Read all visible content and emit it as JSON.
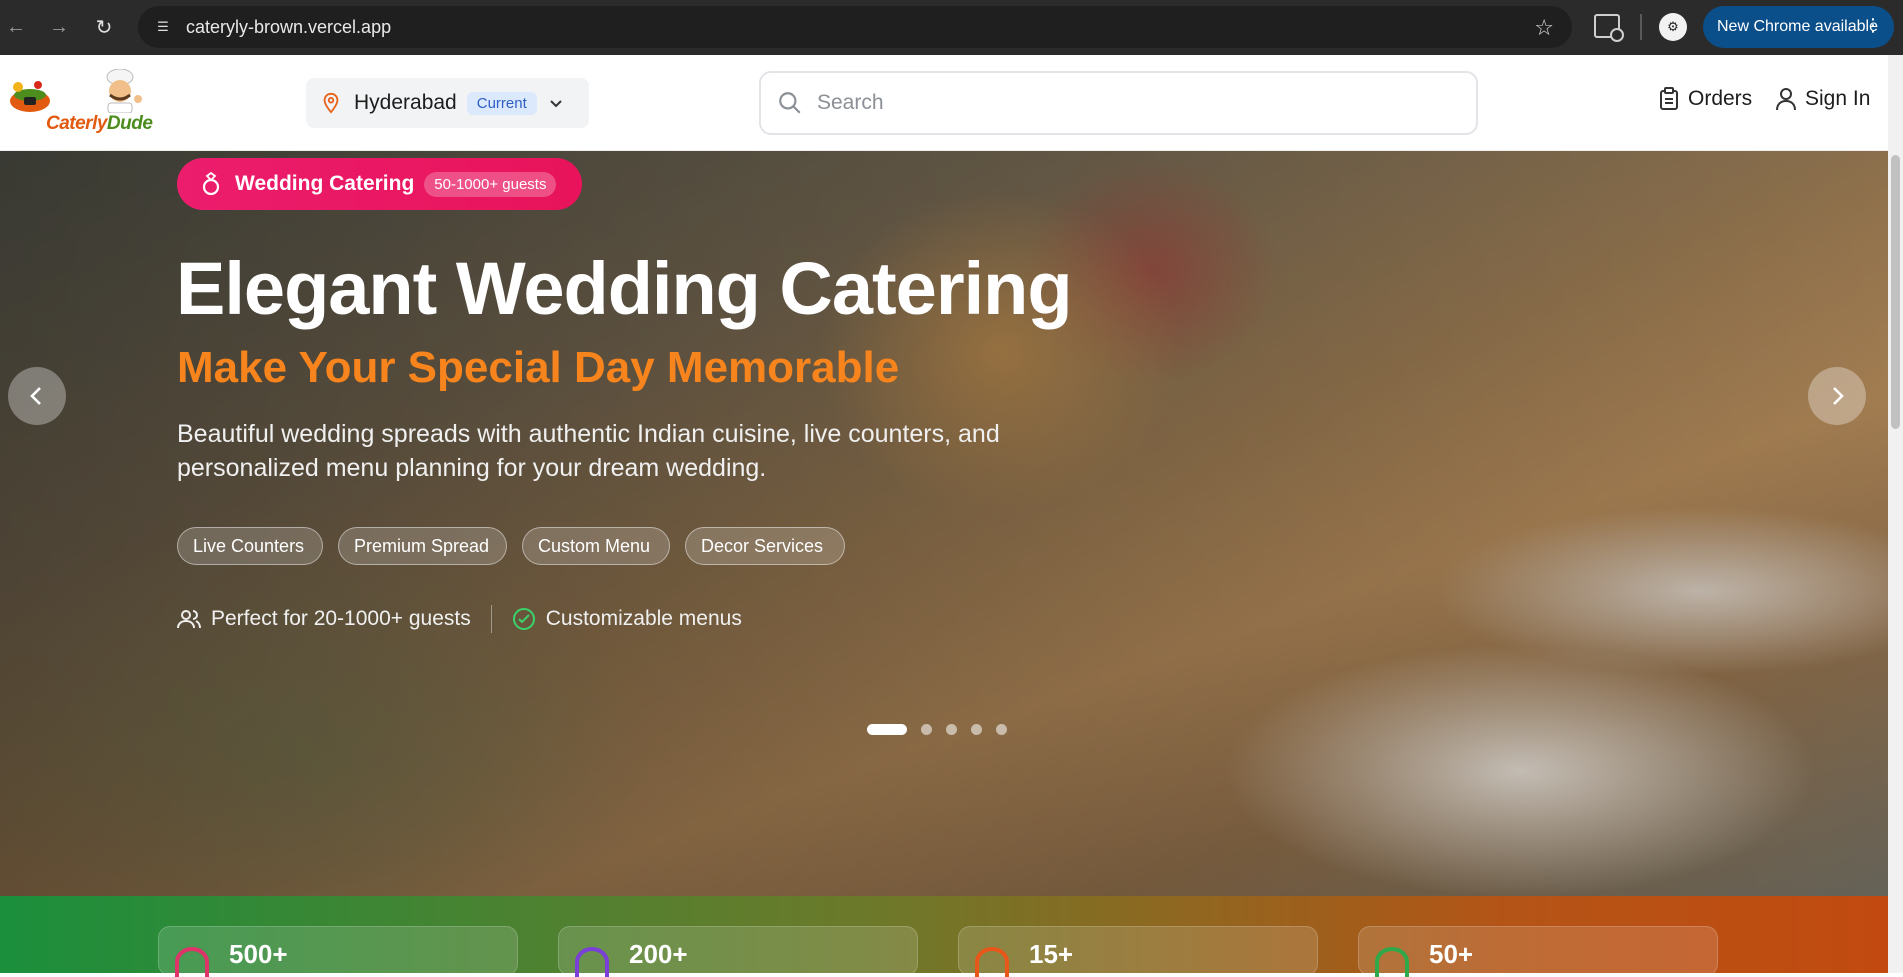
{
  "browser": {
    "url": "cateryly-brown.vercel.app",
    "update_label": "New Chrome available"
  },
  "header": {
    "logo_text_1": "Caterly",
    "logo_text_2": "Dude",
    "location": {
      "city": "Hyderabad",
      "badge": "Current"
    },
    "search_placeholder": "Search",
    "orders_label": "Orders",
    "signin_label": "Sign In"
  },
  "hero": {
    "category_label": "Wedding Catering",
    "category_guests": "50-1000+ guests",
    "title": "Elegant Wedding Catering",
    "subtitle": "Make Your Special Day Memorable",
    "description": "Beautiful wedding spreads with authentic Indian cuisine, live counters, and personalized menu planning for your dream wedding.",
    "chips": [
      "Live Counters",
      "Premium Spread",
      "Custom Menu",
      "Decor Services"
    ],
    "feature_guests": "Perfect for 20-1000+ guests",
    "feature_menus": "Customizable menus",
    "slide_count": 5,
    "active_slide": 1
  },
  "stats": [
    {
      "value": "500+",
      "icon": "heart-icon",
      "color": "#e0336a"
    },
    {
      "value": "200+",
      "icon": "users-icon",
      "color": "#7a3fd8"
    },
    {
      "value": "15+",
      "icon": "award-icon",
      "color": "#e8561a"
    },
    {
      "value": "50+",
      "icon": "utensils-icon",
      "color": "#2fa84a"
    }
  ],
  "colors": {
    "accent_orange": "#f7841c",
    "badge_pink": "#ec1d6d",
    "current_badge_bg": "#dce8fb"
  }
}
